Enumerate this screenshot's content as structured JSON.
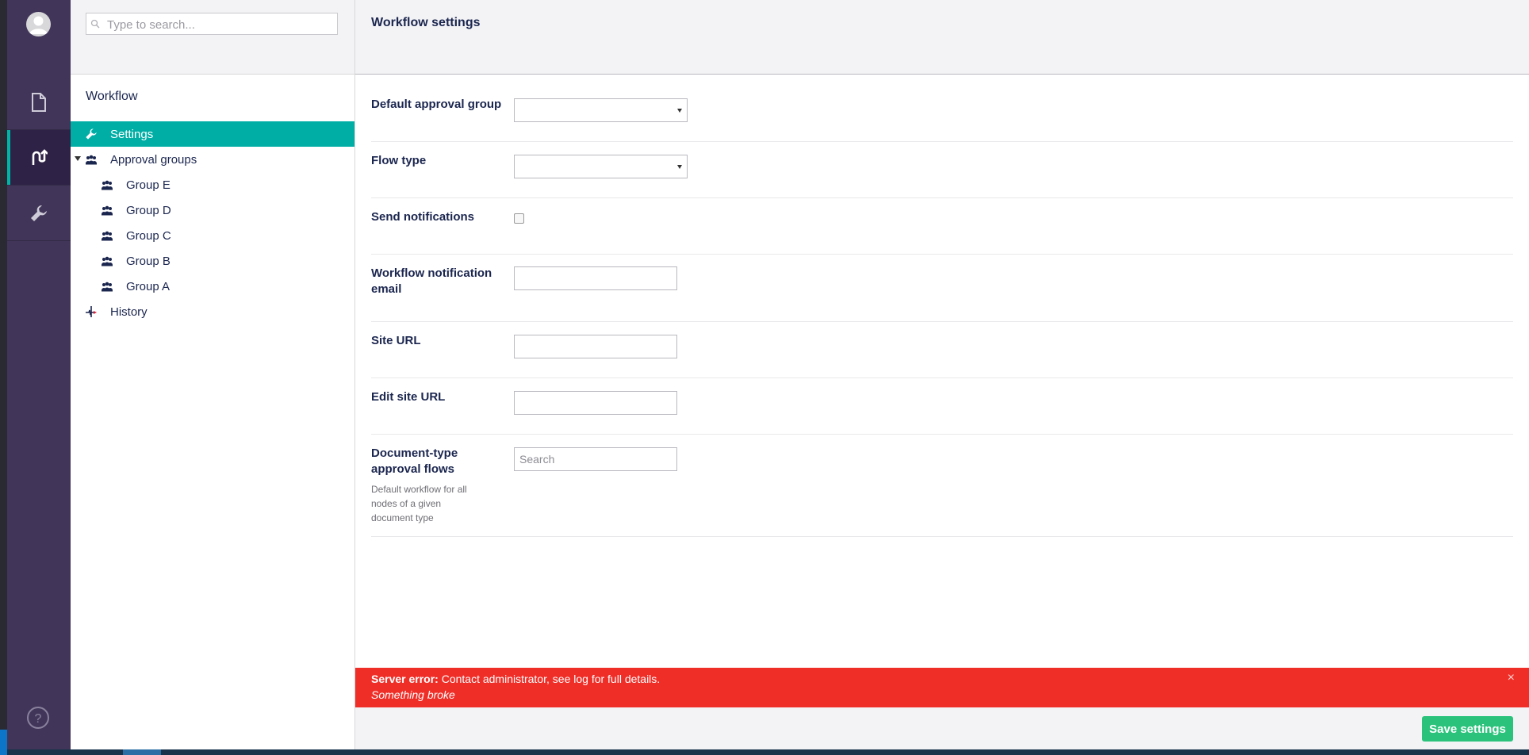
{
  "app": {
    "accent_color": "#00aea5",
    "sidebar_color": "#413659",
    "error_color": "#f02e28",
    "save_color": "#2bc37c"
  },
  "sections": {
    "items": [
      {
        "name": "content",
        "icon": "document-icon",
        "active": false
      },
      {
        "name": "workflow",
        "icon": "workflow-icon",
        "active": true
      },
      {
        "name": "settings",
        "icon": "wrench-icon",
        "active": false
      }
    ],
    "help_icon": "help-icon"
  },
  "tree": {
    "search_placeholder": "Type to search...",
    "root_label": "Workflow",
    "nodes": [
      {
        "label": "Settings",
        "icon": "wrench-icon",
        "selected": true
      },
      {
        "label": "Approval groups",
        "icon": "group-icon",
        "expanded": true
      },
      {
        "label": "Group E",
        "icon": "group-icon"
      },
      {
        "label": "Group D",
        "icon": "group-icon"
      },
      {
        "label": "Group C",
        "icon": "group-icon"
      },
      {
        "label": "Group B",
        "icon": "group-icon"
      },
      {
        "label": "Group A",
        "icon": "group-icon"
      },
      {
        "label": "History",
        "icon": "history-icon"
      }
    ]
  },
  "header": {
    "title": "Workflow settings"
  },
  "form": {
    "default_approval_group": {
      "label": "Default approval group",
      "value": ""
    },
    "flow_type": {
      "label": "Flow type",
      "value": ""
    },
    "send_notifications": {
      "label": "Send notifications",
      "checked": false
    },
    "notification_email": {
      "label": "Workflow notification email",
      "value": ""
    },
    "site_url": {
      "label": "Site URL",
      "value": ""
    },
    "edit_site_url": {
      "label": "Edit site URL",
      "value": ""
    },
    "doctype_flows": {
      "label": "Document-type approval flows",
      "description": "Default workflow for all nodes of a given document type",
      "placeholder": "Search"
    }
  },
  "error": {
    "title": "Server error:",
    "message": " Contact administrator, see log for full details.",
    "detail": "Something broke",
    "close": "×"
  },
  "footer": {
    "save_label": "Save settings"
  }
}
